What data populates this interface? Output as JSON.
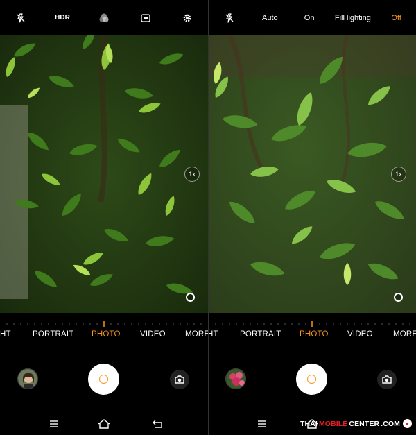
{
  "left": {
    "toolbar": {
      "hdr_label": "HDR",
      "flash_icon": "flash-off-icon",
      "filter_icon": "filters-icon",
      "ratio_icon": "aspect-ratio-icon",
      "settings_icon": "gear-icon"
    },
    "zoom_label": "1x",
    "modes": [
      "HT",
      "PORTRAIT",
      "PHOTO",
      "VIDEO",
      "MORE"
    ],
    "active_mode": "PHOTO"
  },
  "right": {
    "toolbar": {
      "flash_icon": "flash-off-icon",
      "options": [
        "Auto",
        "On",
        "Fill lighting",
        "Off"
      ],
      "active_option": "Off"
    },
    "zoom_label": "1x",
    "modes": [
      "HT",
      "PORTRAIT",
      "PHOTO",
      "VIDEO",
      "MORE"
    ],
    "active_mode": "PHOTO"
  },
  "watermark": {
    "part1": "THAI",
    "part2": "MOBILE",
    "part3": "CENTER",
    "part4": ".COM"
  },
  "colors": {
    "accent": "#f7941d",
    "background": "#000000"
  }
}
